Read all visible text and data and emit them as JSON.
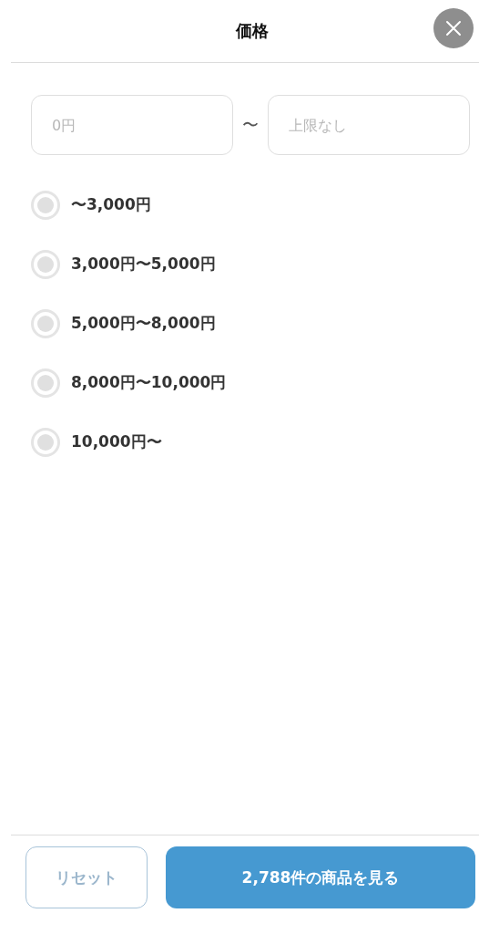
{
  "header": {
    "title": "価格"
  },
  "range": {
    "min": {
      "placeholder": "0円"
    },
    "separator": "〜",
    "max": {
      "placeholder": "上限なし"
    }
  },
  "options": [
    {
      "label": "〜3,000円",
      "selected": false
    },
    {
      "label": "3,000円〜5,000円",
      "selected": false
    },
    {
      "label": "5,000円〜8,000円",
      "selected": false
    },
    {
      "label": "8,000円〜10,000円",
      "selected": false
    },
    {
      "label": "10,000円〜",
      "selected": false
    }
  ],
  "footer": {
    "reset": "リセット",
    "submit": "2,788件の商品を見る"
  }
}
